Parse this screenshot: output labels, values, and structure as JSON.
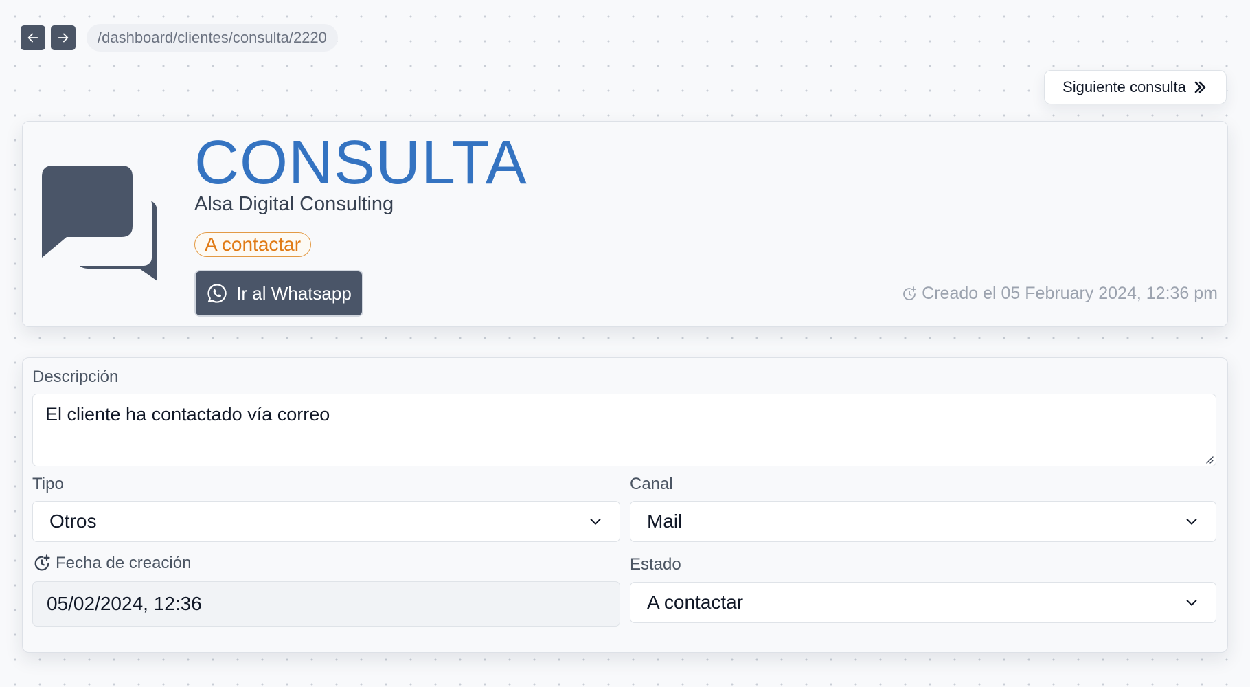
{
  "nav": {
    "back_icon": "arrow-left-icon",
    "forward_icon": "arrow-right-icon",
    "url": "/dashboard/clientes/consulta/2220"
  },
  "next_button": {
    "label": "Siguiente consulta",
    "icon": "chevrons-right-icon"
  },
  "header": {
    "icon": "chat-bubbles-icon",
    "title": "CONSULTA",
    "company": "Alsa Digital Consulting",
    "status": "A contactar",
    "whatsapp_button": "Ir al Whatsapp",
    "created_text": "Creado el 05 February 2024, 12:36 pm"
  },
  "form": {
    "description_label": "Descripción",
    "description_value": "El cliente ha contactado vía correo",
    "tipo_label": "Tipo",
    "tipo_value": "Otros",
    "canal_label": "Canal",
    "canal_value": "Mail",
    "fecha_label": "Fecha de creación",
    "fecha_value": "05/02/2024, 12:36",
    "estado_label": "Estado",
    "estado_value": "A contactar"
  },
  "colors": {
    "accent_blue": "#3473c1",
    "status_orange": "#e07a14",
    "dark_slate": "#4a5568",
    "muted_text": "#9ca3af"
  }
}
